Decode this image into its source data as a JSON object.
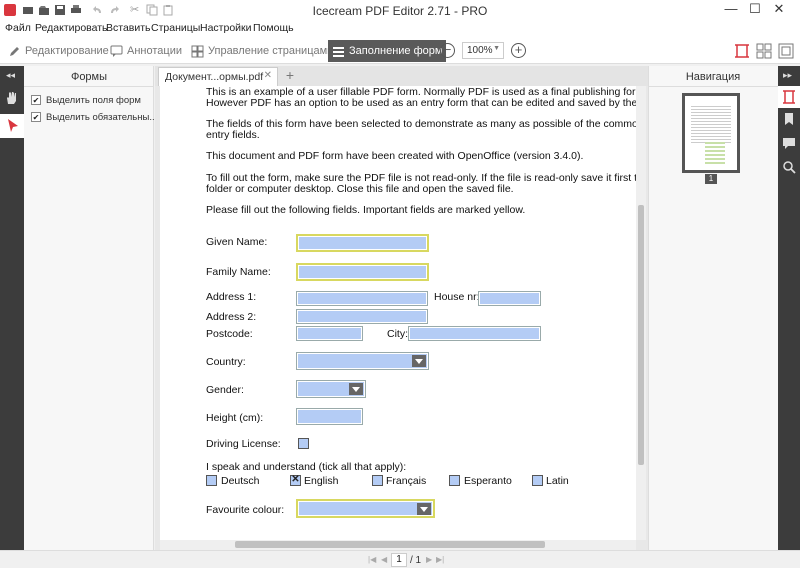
{
  "app": {
    "title": "Icecream PDF Editor 2.71 - PRO",
    "minimize": "—",
    "maximize": "☐",
    "close": "✕"
  },
  "menu": [
    "Файл",
    "Редактировать",
    "Вставить",
    "Страницы",
    "Настройки",
    "Помощь"
  ],
  "toolbar": {
    "edit": "Редактирование",
    "annotations": "Аннотации",
    "page_management": "Управление страницами",
    "form_fill": "Заполнение форм",
    "zoom": "100%"
  },
  "left_panel": {
    "title": "Формы",
    "options": [
      {
        "label": "Выделить поля форм",
        "checked": true
      },
      {
        "label": "Выделить обязательны...",
        "checked": true
      }
    ]
  },
  "document": {
    "tab": "Документ...ормы.pdf",
    "add_tab": "+",
    "paragraphs": [
      "This is an example of a user fillable PDF form. Normally PDF is used as a final publishing format.",
      "However PDF has an option to be used as an entry form that can be edited and saved by the user.",
      "The fields of this form have been selected to demonstrate as many as possible of the common",
      "entry fields.",
      "This document and PDF form have been created with OpenOffice (version 3.4.0).",
      "To fill out the form, make sure the PDF file is not read-only. If the file is read-only save it first to a",
      "folder or computer desktop. Close this file and open the saved file.",
      "Please fill out the following fields. Important fields are marked yellow."
    ],
    "labels": {
      "given_name": "Given Name:",
      "family_name": "Family Name:",
      "address1": "Address 1:",
      "house_nr": "House nr:",
      "address2": "Address 2:",
      "postcode": "Postcode:",
      "city": "City:",
      "country": "Country:",
      "gender": "Gender:",
      "height": "Height (cm):",
      "driving_license": "Driving License:",
      "languages": "I speak and understand (tick all that apply):",
      "favourite_colour": "Favourite colour:"
    },
    "languages": [
      {
        "name": "Deutsch",
        "checked": false
      },
      {
        "name": "English",
        "checked": true
      },
      {
        "name": "Français",
        "checked": false
      },
      {
        "name": "Esperanto",
        "checked": false
      },
      {
        "name": "Latin",
        "checked": false
      }
    ],
    "check_mark": "✕"
  },
  "right_panel": {
    "title": "Навигация",
    "page_number": "1"
  },
  "status": {
    "current_page": "1",
    "total_pages": "/ 1"
  },
  "colors": {
    "field_fill": "#b4ccf5",
    "required_border": "#d8d860",
    "accent": "#d9363e"
  }
}
